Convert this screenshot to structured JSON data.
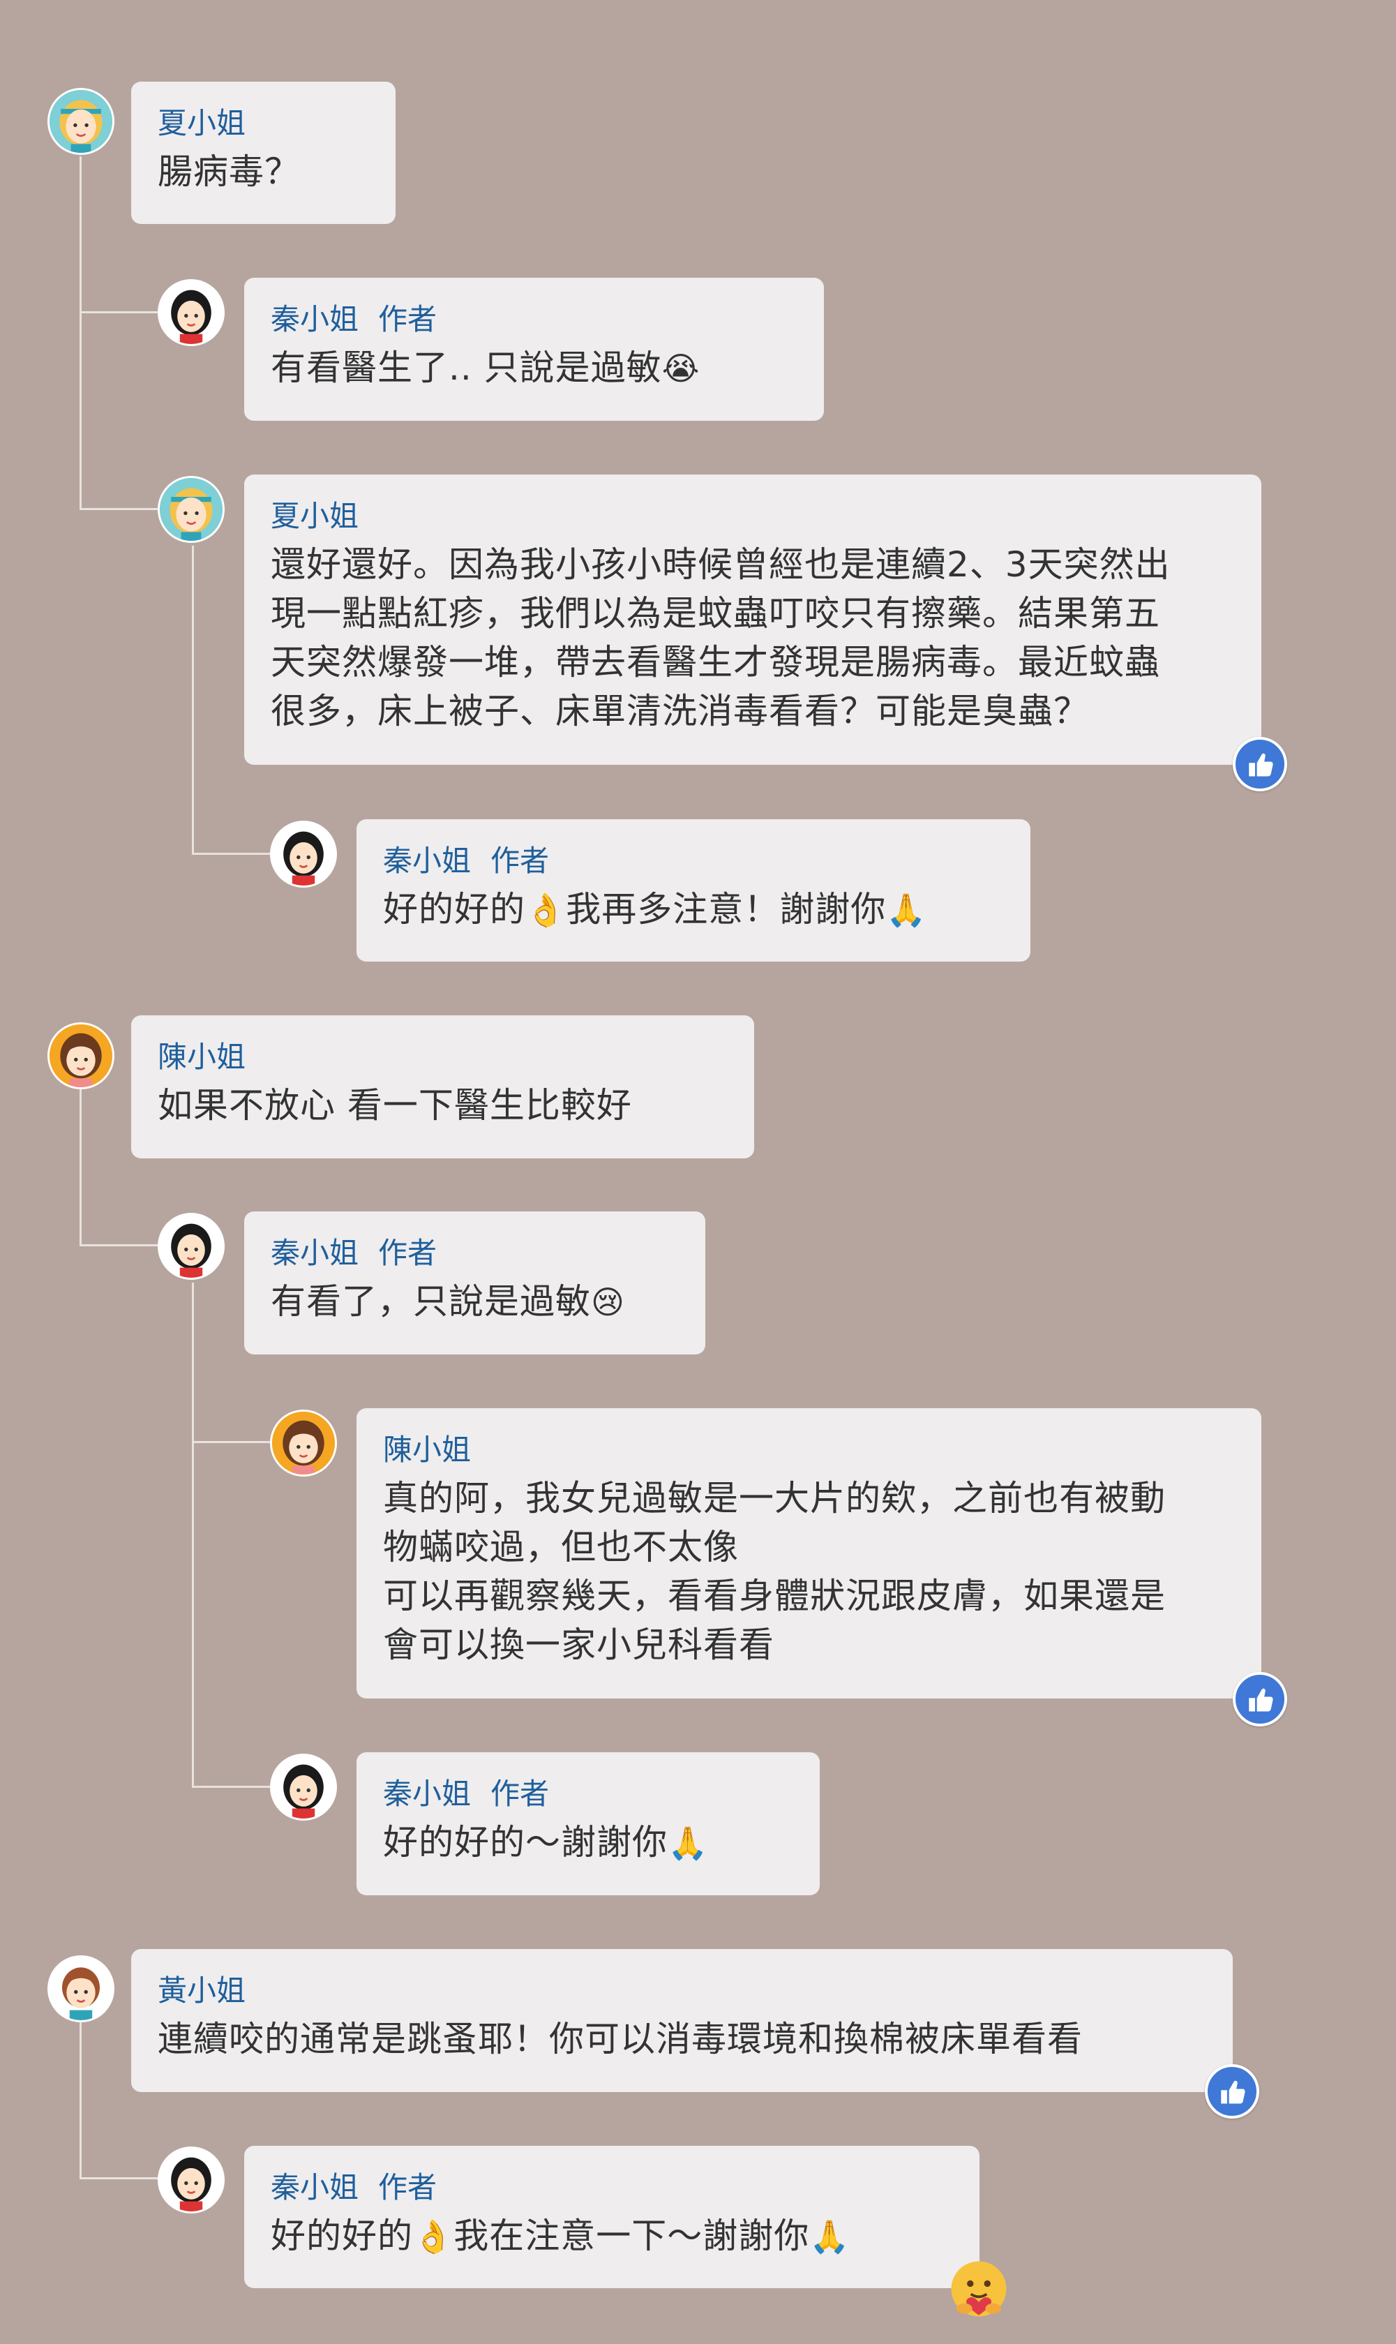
{
  "colors": {
    "background": "#b6a59e",
    "bubble": "#efedee",
    "name": "#1f5f9c",
    "text": "#333333",
    "thread_line": "#e9e2de",
    "like": "#3f78d6"
  },
  "comments": [
    {
      "id": "c1",
      "user": "夏小姐",
      "author_tag": "",
      "text": "腸病毒？",
      "avatar": "avatar-blonde",
      "reaction": ""
    },
    {
      "id": "c2",
      "user": "秦小姐",
      "author_tag": "作者",
      "text": "有看醫生了.. 只說是過敏",
      "emoji": "loudly-crying-face",
      "emoji_char": "😭",
      "avatar": "avatar-black-hair",
      "reaction": ""
    },
    {
      "id": "c3",
      "user": "夏小姐",
      "author_tag": "",
      "text": "還好還好。因為我小孩小時候曾經也是連續2、3天突然出\n現一點點紅疹，我們以為是蚊蟲叮咬只有擦藥。結果第五\n天突然爆發一堆，帶去看醫生才發現是腸病毒。最近蚊蟲\n很多，床上被子、床單清洗消毒看看？可能是臭蟲？",
      "avatar": "avatar-blonde",
      "reaction": "like"
    },
    {
      "id": "c4",
      "user": "秦小姐",
      "author_tag": "作者",
      "text": "好的好的",
      "emoji": "ok-hand",
      "emoji_char": "👌",
      "text_after": "我再多注意！謝謝你",
      "emoji2": "folded-hands",
      "emoji2_char": "🙏",
      "avatar": "avatar-black-hair",
      "reaction": ""
    },
    {
      "id": "c5",
      "user": "陳小姐",
      "author_tag": "",
      "text": "如果不放心 看一下醫生比較好",
      "avatar": "avatar-brown-orange",
      "reaction": ""
    },
    {
      "id": "c6",
      "user": "秦小姐",
      "author_tag": "作者",
      "text": "有看了，只說是過敏",
      "emoji": "crying-face",
      "emoji_char": "😢",
      "avatar": "avatar-black-hair",
      "reaction": ""
    },
    {
      "id": "c7",
      "user": "陳小姐",
      "author_tag": "",
      "text": "真的阿，我女兒過敏是一大片的欸，之前也有被動\n物蟎咬過，但也不太像\n可以再觀察幾天，看看身體狀況跟皮膚，如果還是\n會可以換一家小兒科看看",
      "avatar": "avatar-brown-orange",
      "reaction": "like"
    },
    {
      "id": "c8",
      "user": "秦小姐",
      "author_tag": "作者",
      "text": "好的好的～謝謝你",
      "emoji": "folded-hands",
      "emoji_char": "🙏",
      "avatar": "avatar-black-hair",
      "reaction": ""
    },
    {
      "id": "c9",
      "user": "黃小姐",
      "author_tag": "",
      "text": "連續咬的通常是跳蚤耶！你可以消毒環境和換棉被床單看看",
      "avatar": "avatar-brown-teal",
      "reaction": "like"
    },
    {
      "id": "c10",
      "user": "秦小姐",
      "author_tag": "作者",
      "text": "好的好的",
      "emoji": "ok-hand",
      "emoji_char": "👌",
      "text_after": "我在注意一下～謝謝你",
      "emoji2": "folded-hands",
      "emoji2_char": "🙏",
      "avatar": "avatar-black-hair",
      "reaction": "care"
    }
  ]
}
